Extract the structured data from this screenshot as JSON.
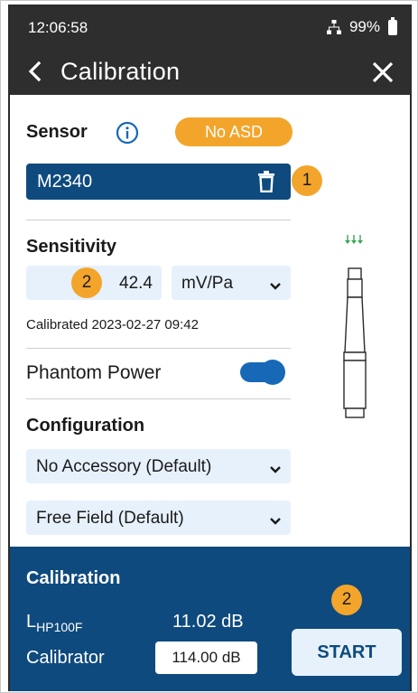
{
  "status_bar": {
    "time": "12:06:58",
    "battery": "99%",
    "network_icon": "network-icon",
    "battery_icon": "battery-icon"
  },
  "header": {
    "title": "Calibration",
    "back_icon": "chevron-left-icon",
    "close_icon": "close-icon"
  },
  "sensor": {
    "label": "Sensor",
    "badge": "No ASD",
    "value": "M2340",
    "callout": "1"
  },
  "sensitivity": {
    "label": "Sensitivity",
    "callout": "2",
    "value": "42.4",
    "unit": "mV/Pa",
    "calibrated": "Calibrated 2023-02-27 09:42"
  },
  "phantom_power": {
    "label": "Phantom Power",
    "enabled": true
  },
  "configuration": {
    "label": "Configuration",
    "accessory": "No Accessory (Default)",
    "field": "Free Field (Default)"
  },
  "calibration_panel": {
    "title": "Calibration",
    "lhp_label": "L",
    "lhp_sub": "HP100F",
    "lhp_value": "11.02 dB",
    "calibrator_label": "Calibrator",
    "calibrator_value": "114.00 dB",
    "start_label": "START",
    "callout": "2"
  },
  "colors": {
    "header_bg": "#2e2e2e",
    "accent_blue": "#0e4a7e",
    "toggle_blue": "#1769b8",
    "orange": "#f3a52b",
    "field_bg": "#e6f1fb",
    "mic_arrow": "#3aa655"
  }
}
